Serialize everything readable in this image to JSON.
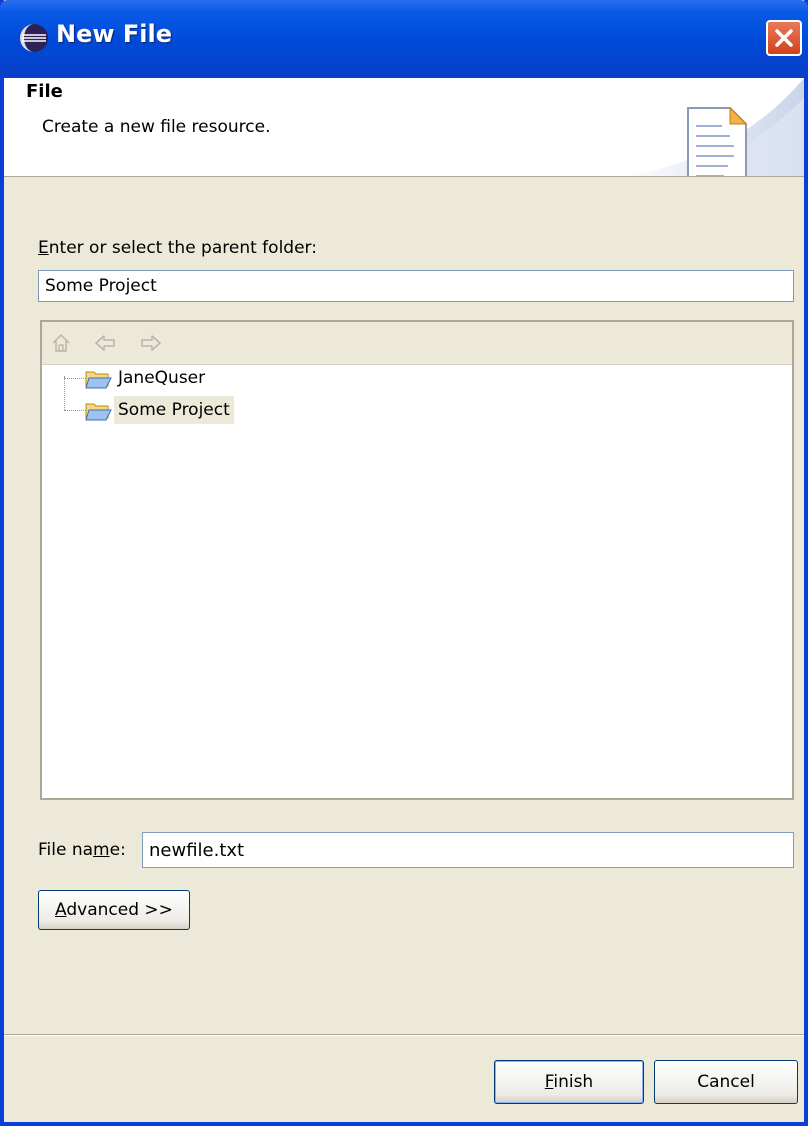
{
  "window": {
    "title": "New File",
    "title_icon": "eclipse-icon",
    "close_icon": "close-icon"
  },
  "header": {
    "title": "File",
    "description": "Create a new file resource.",
    "icon": "new-file-wizard-icon"
  },
  "parent_folder": {
    "label_mnemonic": "E",
    "label_rest": "nter or select the parent folder:",
    "value": "Some Project"
  },
  "tree": {
    "toolbar_icons": [
      "home-icon",
      "back-arrow-icon",
      "forward-arrow-icon"
    ],
    "items": [
      {
        "label": "JaneQuser",
        "icon": "open-folder-icon",
        "selected": false
      },
      {
        "label": "Some Project",
        "icon": "open-folder-icon",
        "selected": true
      }
    ]
  },
  "file_name": {
    "label_pre": "File na",
    "label_mnemonic": "m",
    "label_post": "e:",
    "value": "newfile.txt"
  },
  "buttons": {
    "advanced_mnemonic": "A",
    "advanced_rest": "dvanced >>",
    "finish_mnemonic": "F",
    "finish_rest": "inish",
    "cancel": "Cancel"
  },
  "colors": {
    "titlebar": "#0049d8",
    "dialog_bg": "#ece9d8",
    "selection": "#ece9d8",
    "close_button": "#d3411a"
  }
}
